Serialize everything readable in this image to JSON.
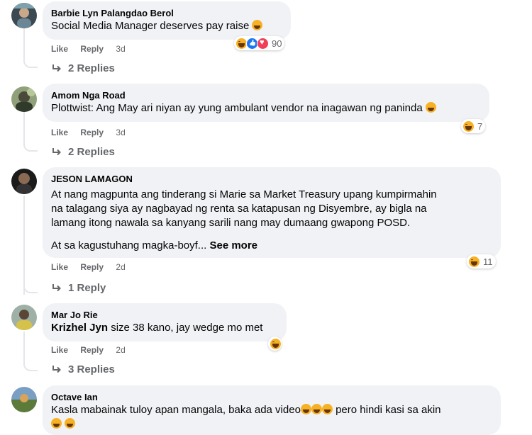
{
  "comments": [
    {
      "author": "Barbie Lyn Palangdao Berol",
      "text": "Social Media Manager deserves pay raise",
      "like": "Like",
      "reply": "Reply",
      "time": "3d",
      "reaction_count": "90",
      "replies": "2 Replies"
    },
    {
      "author": "Amom Nga Road",
      "text": "Plottwist: Ang May ari niyan ay yung ambulant vendor na inagawan ng paninda",
      "like": "Like",
      "reply": "Reply",
      "time": "3d",
      "reaction_count": "7",
      "replies": "2 Replies"
    },
    {
      "author": "JESON LAMAGON",
      "text_line1": "At nang magpunta ang tinderang si Marie sa Market Treasury upang kumpirmahin",
      "text_line2": "na talagang siya ay nagbayad ng renta sa katapusan ng Disyembre, ay bigla na",
      "text_line3": "lamang itong nawala sa kanyang sarili nang may dumaang gwapong POSD.",
      "text_line4": "At sa kagustuhang magka-boyf...",
      "see_more": "See more",
      "like": "Like",
      "reply": "Reply",
      "time": "2d",
      "reaction_count": "11",
      "replies": "1 Reply"
    },
    {
      "author": "Mar Jo Rie",
      "tag": "Krizhel Jyn",
      "text": " size 38 kano, jay wedge mo met",
      "like": "Like",
      "reply": "Reply",
      "time": "2d",
      "replies": "3 Replies"
    },
    {
      "author": "Octave Ian",
      "text_part1": "Kasla mabainak tuloy apan mangala, baka ada video",
      "text_part2": " pero hindi kasi sa akin"
    }
  ]
}
